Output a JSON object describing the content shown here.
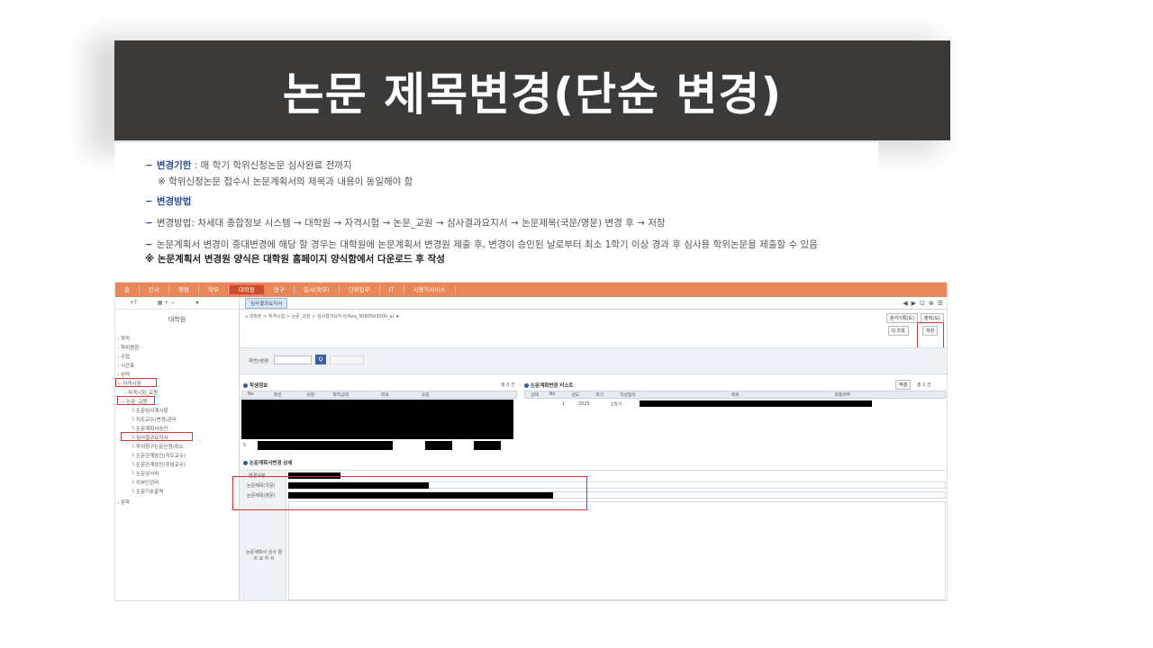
{
  "slide": {
    "title": "논문 제목변경(단순 변경)"
  },
  "notes": {
    "line1_key": "변경기한",
    "line1_text": " : 매 학기 학위신청논문 심사완료 전까지",
    "line2": "※ 학위신청논문 접수시 논문계획서의 제목과 내용이 동일해야 함",
    "line3_key": "변경방법",
    "line4": "변경방법: 차세대 종합정보 시스템 → 대학원 → 자격시험 → 논문_교원 → 심사결과요지서 → 논문제목(국문/영문) 변경 후 → 저장",
    "line5": "논문계획서 변경이 중대변경에 해당 할 경우는 대학원에 논문계획서 변경원 제출 후, 변경이 승인된 날로부터 최소 1학기 이상 경과 후 심사용 학위논문을 제출할 수 있음",
    "line6": "※ 논문계획서 변경원 양식은 대학원 홈페이지 양식함에서 다운로드 후 작성",
    "dash": "−"
  },
  "app": {
    "top_menu": [
      "홈",
      "인사",
      "행정",
      "학부",
      "대학원",
      "연구",
      "입시(학부)",
      "단위업무",
      "IT",
      "사용자서비스"
    ],
    "active_menu": "대학원",
    "sidebar_tools": [
      "+T",
      "▦ + −",
      "★"
    ],
    "sidebar_title": "대학원",
    "tree": [
      "› 학적",
      "› 학위명칭",
      "› 수업",
      "› 시간표",
      "› 성적",
      "− 자격시험",
      "› 자격시험_교원",
      "− 논문_교원",
      "└ 논문심사계시험",
      "└ 지도교수(변경)관리",
      "└ 논문계획서승인",
      "└ 심사결과요지서",
      "└ 학위청구논문신청/취소",
      "└ 논문관계승인(지도교수)",
      "└ 논문관계승인(주임교수)",
      "└ 논문심사비",
      "└ 외부인관리",
      "└ 논문기초출력",
      "› 장학"
    ],
    "tab_label": "심사결과요지서",
    "window_controls": [
      "◀",
      "▶",
      "⊡",
      "⊗",
      "☰"
    ],
    "breadcrumb": "⌂ 대학원 > 자격시험 > 논문_교원 > 심사결과요지서(Req_3080503000_a) ★",
    "btn_download": "분석기록(도)",
    "btn_print": "출력(도)",
    "btn_search": "Q 조회",
    "btn_save": "저장",
    "search_label": "학번/성명",
    "search_btn": "Q",
    "student_section": "학생정보",
    "student_count": "총 0 건",
    "student_cols": [
      "No",
      "학번",
      "성명",
      "학적상태",
      "학과",
      "과정"
    ],
    "student_row_no": "5",
    "plan_section": "논문계획변경 리스트",
    "plan_count": "총 1 건",
    "plan_tool": "엑셀",
    "plan_cols": [
      "상태",
      "No",
      "년도",
      "학기",
      "작성일자",
      "제목",
      "최종여부"
    ],
    "plan_row": [
      "",
      "1",
      "2025",
      "1학기"
    ],
    "detail_section": "논문계획서변경 상세",
    "field_type": "변경구분",
    "field_ko": "논문제목(국문)",
    "field_en": "논문제목(영문)",
    "side_label": "논문계획서 심사 결과 요 지 서"
  },
  "colors": {
    "banner_bg": "#3b3a39",
    "menu_bg": "#e8875a",
    "accent_blue": "#2b4f9c",
    "highlight_red": "#e03131"
  }
}
